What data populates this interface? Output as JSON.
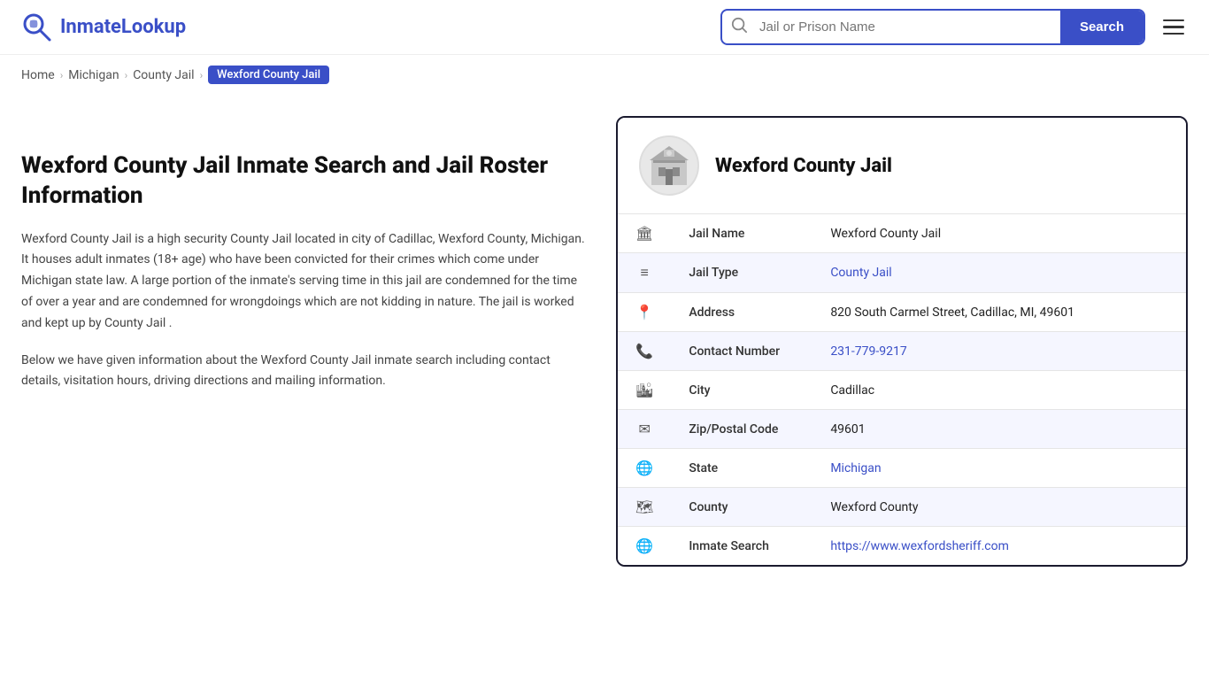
{
  "header": {
    "logo_text_plain": "Inmate",
    "logo_text_accent": "Lookup",
    "search_placeholder": "Jail or Prison Name",
    "search_button_label": "Search",
    "menu_label": "Menu"
  },
  "breadcrumb": {
    "home": "Home",
    "state": "Michigan",
    "type": "County Jail",
    "active": "Wexford County Jail"
  },
  "left": {
    "title": "Wexford County Jail Inmate Search and Jail Roster Information",
    "desc1": "Wexford County Jail is a high security County Jail located in city of Cadillac, Wexford County, Michigan. It houses adult inmates (18+ age) who have been convicted for their crimes which come under Michigan state law. A large portion of the inmate's serving time in this jail are condemned for the time of over a year and are condemned for wrongdoings which are not kidding in nature. The jail is worked and kept up by County Jail .",
    "desc2": "Below we have given information about the Wexford County Jail inmate search including contact details, visitation hours, driving directions and mailing information."
  },
  "card": {
    "facility_name": "Wexford County Jail",
    "rows": [
      {
        "icon": "🏛",
        "label": "Jail Name",
        "value": "Wexford County Jail",
        "link": false
      },
      {
        "icon": "≡",
        "label": "Jail Type",
        "value": "County Jail",
        "link": true,
        "href": "#"
      },
      {
        "icon": "📍",
        "label": "Address",
        "value": "820 South Carmel Street, Cadillac, MI, 49601",
        "link": false
      },
      {
        "icon": "📞",
        "label": "Contact Number",
        "value": "231-779-9217",
        "link": true,
        "href": "tel:2317799217"
      },
      {
        "icon": "🏙",
        "label": "City",
        "value": "Cadillac",
        "link": false
      },
      {
        "icon": "✉",
        "label": "Zip/Postal Code",
        "value": "49601",
        "link": false
      },
      {
        "icon": "🌐",
        "label": "State",
        "value": "Michigan",
        "link": true,
        "href": "#"
      },
      {
        "icon": "🗺",
        "label": "County",
        "value": "Wexford County",
        "link": false
      },
      {
        "icon": "🌐",
        "label": "Inmate Search",
        "value": "https://www.wexfordsheriff.com",
        "link": true,
        "href": "https://www.wexfordsheriff.com"
      }
    ]
  },
  "colors": {
    "accent": "#3a4fc7",
    "dark_border": "#1a1a2e"
  }
}
